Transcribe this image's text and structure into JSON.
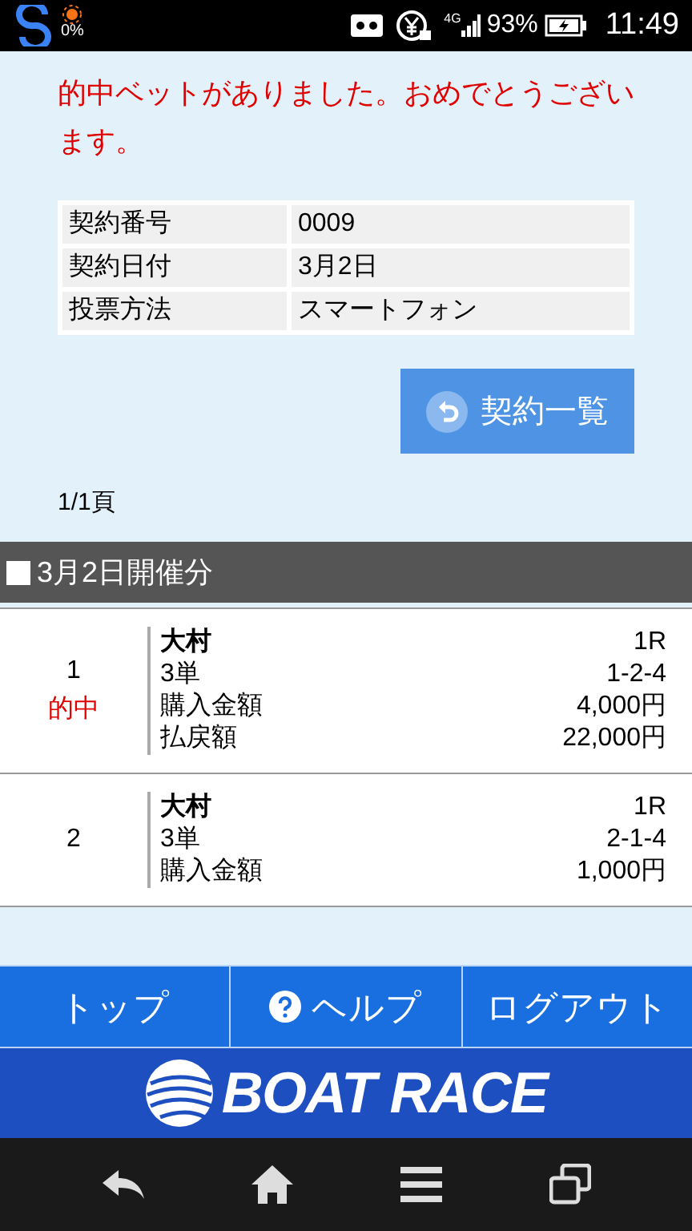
{
  "status_bar": {
    "app_percent": "0%",
    "network": "4G",
    "battery": "93%",
    "time": "11:49"
  },
  "message": "的中ベットがありました。おめでとうございます。",
  "contract": [
    {
      "label": "契約番号",
      "value": "0009"
    },
    {
      "label": "契約日付",
      "value": "3月2日"
    },
    {
      "label": "投票方法",
      "value": "スマートフォン"
    }
  ],
  "list_button": "契約一覧",
  "page": "1/1頁",
  "section_title": "3月2日開催分",
  "bets": [
    {
      "number": "1",
      "result": "的中",
      "lines": [
        {
          "label": "大村",
          "value": "1R"
        },
        {
          "label": "3単",
          "value": "1-2-4"
        },
        {
          "label": "購入金額",
          "value": "4,000円"
        },
        {
          "label": "払戻額",
          "value": "22,000円"
        }
      ]
    },
    {
      "number": "2",
      "lines": [
        {
          "label": "大村",
          "value": "1R"
        },
        {
          "label": "3単",
          "value": "2-1-4"
        },
        {
          "label": "購入金額",
          "value": "1,000円"
        }
      ]
    }
  ],
  "nav": [
    {
      "label": "トップ",
      "kind": "plain"
    },
    {
      "label": "ヘルプ",
      "kind": "help"
    },
    {
      "label": "ログアウト",
      "kind": "plain"
    }
  ],
  "logo": "BOAT RACE"
}
